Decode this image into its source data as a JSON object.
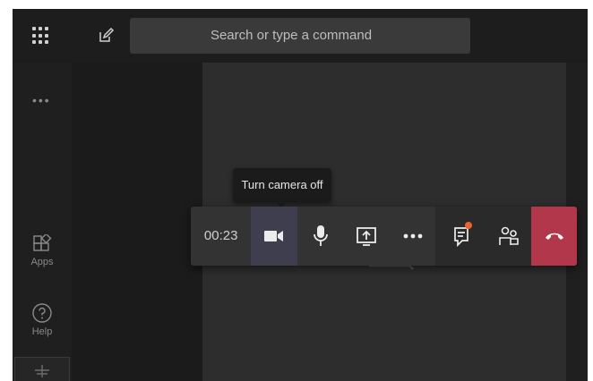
{
  "search": {
    "placeholder": "Search or type a command"
  },
  "rail": {
    "more": "•••",
    "items": [
      {
        "label": "Apps",
        "icon": "apps-icon"
      },
      {
        "label": "Help",
        "icon": "help-icon"
      }
    ]
  },
  "call": {
    "timer": "00:23",
    "tooltip": "Turn camera off",
    "buttons": [
      {
        "name": "camera",
        "icon": "video-camera-icon"
      },
      {
        "name": "microphone",
        "icon": "microphone-icon"
      },
      {
        "name": "share",
        "icon": "share-screen-icon"
      },
      {
        "name": "more",
        "icon": "more-options-icon"
      },
      {
        "name": "chat",
        "icon": "chat-icon"
      },
      {
        "name": "participants",
        "icon": "participants-icon"
      },
      {
        "name": "hang-up",
        "icon": "hang-up-icon"
      }
    ]
  },
  "colors": {
    "hangup": "#b2374a",
    "active": "#3e3e4f",
    "badge": "#e9622f"
  }
}
